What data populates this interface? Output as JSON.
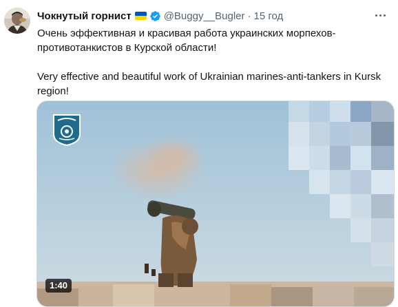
{
  "tweet": {
    "display_name": "Чокнутый горнист",
    "handle": "@Buggy__Bugler",
    "separator": "·",
    "time": "15 год",
    "text_ru": "Очень эффективная и красивая работа украинских морпехов-противотанкистов в Курской области!",
    "text_en": "Very effective and beautiful work of Ukrainian marines-anti-tankers in Kursk region!"
  },
  "media": {
    "duration": "1:40"
  },
  "colors": {
    "text_primary": "#0f1419",
    "text_secondary": "#536471",
    "verified_blue": "#1d9bf0",
    "flag_blue": "#0057b7",
    "flag_yellow": "#ffd700"
  },
  "icons": {
    "verified": "verified-badge-icon",
    "more": "more-horizontal-icon",
    "flag": "ukraine-flag-icon"
  }
}
